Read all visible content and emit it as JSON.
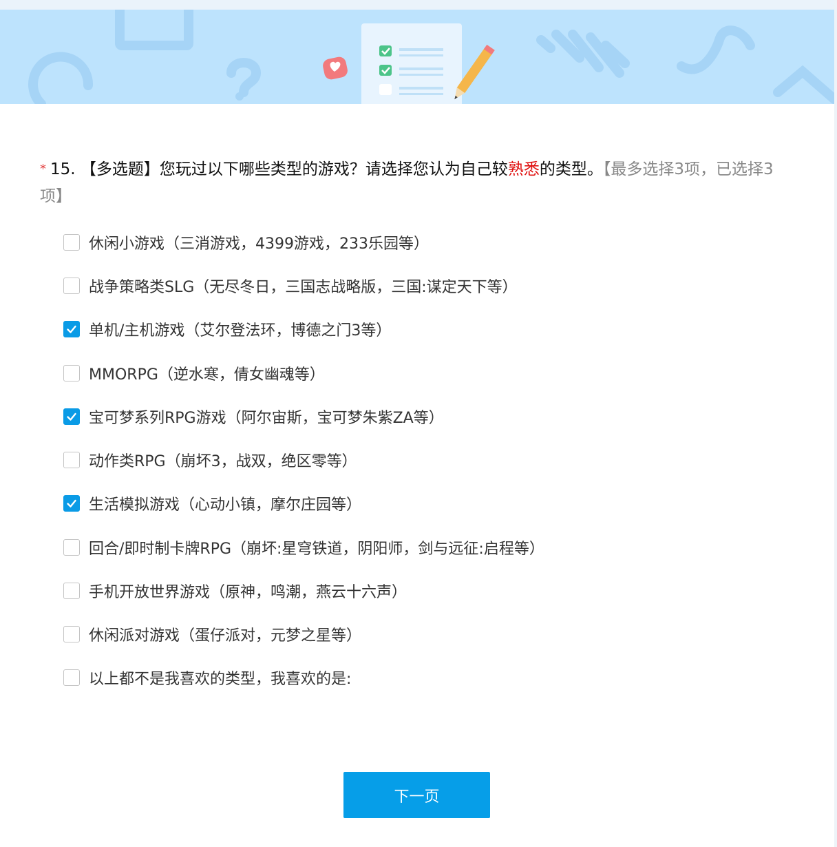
{
  "question": {
    "required_mark": "*",
    "number": "15.",
    "type_tag": "【多选题】",
    "text_before": "您玩过以下哪些类型的游戏？请选择您认为自己较",
    "highlight": "熟悉",
    "text_after": "的类型。",
    "limit_note": "【最多选择3项，已选择3项】"
  },
  "options": [
    {
      "label": "休闲小游戏（三消游戏，4399游戏，233乐园等）",
      "checked": false
    },
    {
      "label": "战争策略类SLG（无尽冬日，三国志战略版，三国:谋定天下等）",
      "checked": false
    },
    {
      "label": "单机/主机游戏（艾尔登法环，博德之门3等）",
      "checked": true
    },
    {
      "label": "MMORPG（逆水寒，倩女幽魂等）",
      "checked": false
    },
    {
      "label": "宝可梦系列RPG游戏（阿尔宙斯，宝可梦朱紫ZA等）",
      "checked": true
    },
    {
      "label": "动作类RPG（崩坏3，战双，绝区零等）",
      "checked": false
    },
    {
      "label": "生活模拟游戏（心动小镇，摩尔庄园等）",
      "checked": true
    },
    {
      "label": "回合/即时制卡牌RPG（崩坏:星穹铁道，阴阳师，剑与远征:启程等）",
      "checked": false
    },
    {
      "label": "手机开放世界游戏（原神，鸣潮，燕云十六声）",
      "checked": false
    },
    {
      "label": "休闲派对游戏（蛋仔派对，元梦之星等）",
      "checked": false
    },
    {
      "label": "以上都不是我喜欢的类型，我喜欢的是:",
      "checked": false
    }
  ],
  "next_button": {
    "label": "下一页"
  },
  "colors": {
    "accent": "#0a9be6",
    "banner": "#bde3fd",
    "highlight": "#e0100f",
    "required": "#e23b3b"
  },
  "icons": {
    "banner": [
      "checklist-icon",
      "pencil-icon",
      "heart-bubble-icon",
      "question-mark-icon"
    ],
    "checkbox": "checkmark-icon"
  }
}
